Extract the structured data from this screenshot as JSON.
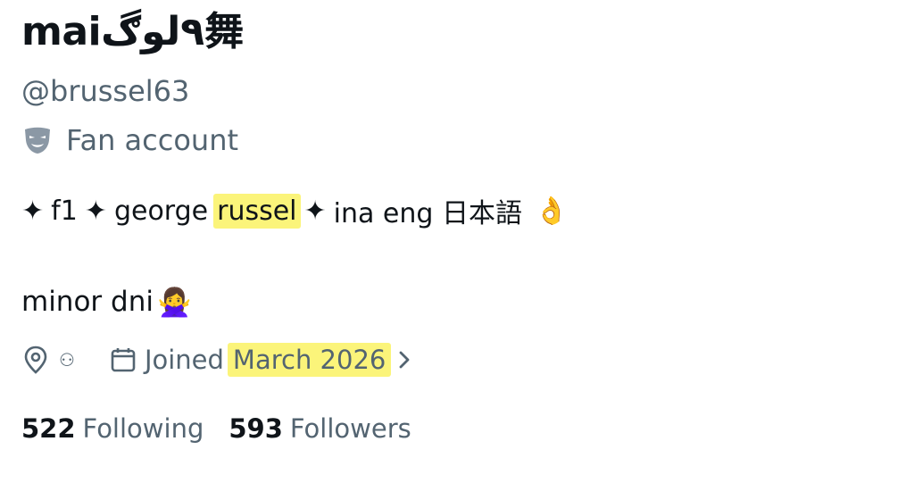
{
  "profile": {
    "display_name": "mai٩لوڰ舞",
    "handle": "@brussel63",
    "category_icon": "theater-mask-icon",
    "category": "Fan account",
    "bio": {
      "star": "✦",
      "f1": "f1",
      "george": "george",
      "russel": "russel",
      "langs": "ina eng 日本語",
      "ok_emoji": "👌",
      "line2": "minor dni",
      "crossed_arms_emoji": "🙅‍♀️"
    },
    "location_icon": "location-pin-icon",
    "location_value": "⚇",
    "joined_icon": "calendar-icon",
    "joined_label": "Joined",
    "joined_date": "March 2026",
    "chevron_icon": "chevron-right-icon",
    "following_count": "522",
    "following_label": "Following",
    "followers_count": "593",
    "followers_label": "Followers"
  },
  "colors": {
    "highlight": "#fbf47a",
    "secondary_text": "#536471",
    "primary_text": "#0f1419"
  }
}
